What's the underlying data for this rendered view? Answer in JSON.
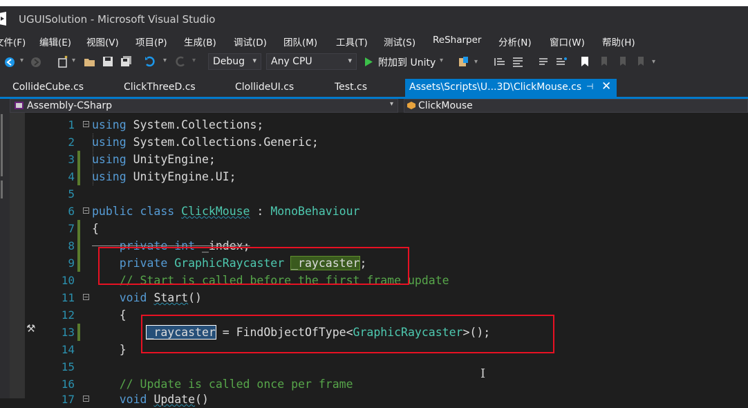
{
  "window": {
    "title": "UGUISolution - Microsoft Visual Studio"
  },
  "menu": [
    "文件(F)",
    "编辑(E)",
    "视图(V)",
    "项目(P)",
    "生成(B)",
    "调试(D)",
    "团队(M)",
    "工具(T)",
    "测试(S)",
    "ReSharper",
    "分析(N)",
    "窗口(W)",
    "帮助(H)"
  ],
  "toolbar": {
    "configuration": "Debug",
    "platform": "Any CPU",
    "attach_label": "附加到 Unity"
  },
  "tabs": [
    "CollideCube.cs",
    "ClickThreeD.cs",
    "ClollideUI.cs",
    "Test.cs"
  ],
  "active_tab": {
    "label": "Assets\\Scripts\\U...3D\\ClickMouse.cs"
  },
  "navbar": {
    "project": "Assembly-CSharp",
    "type": "ClickMouse"
  },
  "colors": {
    "accent": "#007acc",
    "highlight_box": "#e81123",
    "keyword": "#569cd6",
    "type": "#4ec9b0",
    "comment": "#57a64a",
    "line_number": "#2b91af"
  },
  "code": {
    "l1": {
      "num": "1",
      "kw": "using",
      "rest": " System.Collections;"
    },
    "l2": {
      "num": "2",
      "kw": "using",
      "rest": " System.Collections.Generic;"
    },
    "l3": {
      "num": "3",
      "kw": "using",
      "rest": " UnityEngine;"
    },
    "l4": {
      "num": "4",
      "kw": "using",
      "rest": " UnityEngine.UI;"
    },
    "l5": {
      "num": "5"
    },
    "l6": {
      "num": "6",
      "kw1": "public",
      "kw2": "class",
      "name": "ClickMouse",
      "colon": " : ",
      "base": "MonoBehaviour"
    },
    "l7": {
      "num": "7",
      "text": "{"
    },
    "l8": {
      "num": "8",
      "kw1": "private",
      "kw2": "int",
      "ident": " _index;"
    },
    "l9": {
      "num": "9",
      "kw": "private",
      "type": "GraphicRaycaster",
      "field": "_raycaster",
      "end": ";"
    },
    "l10": {
      "num": "10",
      "comment": "// Start is called before the first frame update"
    },
    "l11": {
      "num": "11",
      "kw": "void",
      "name": "Start",
      "end": "()"
    },
    "l12": {
      "num": "12",
      "text": "{"
    },
    "l13": {
      "num": "13",
      "field": "_raycaster",
      "mid": " = FindObjectOfType<",
      "type": "GraphicRaycaster",
      "end": ">();"
    },
    "l14": {
      "num": "14",
      "text": "}"
    },
    "l15": {
      "num": "15"
    },
    "l16": {
      "num": "16",
      "comment": "// Update is called once per frame"
    },
    "l17": {
      "num": "17",
      "kw": "void",
      "name": "Update",
      "end": "()"
    }
  }
}
